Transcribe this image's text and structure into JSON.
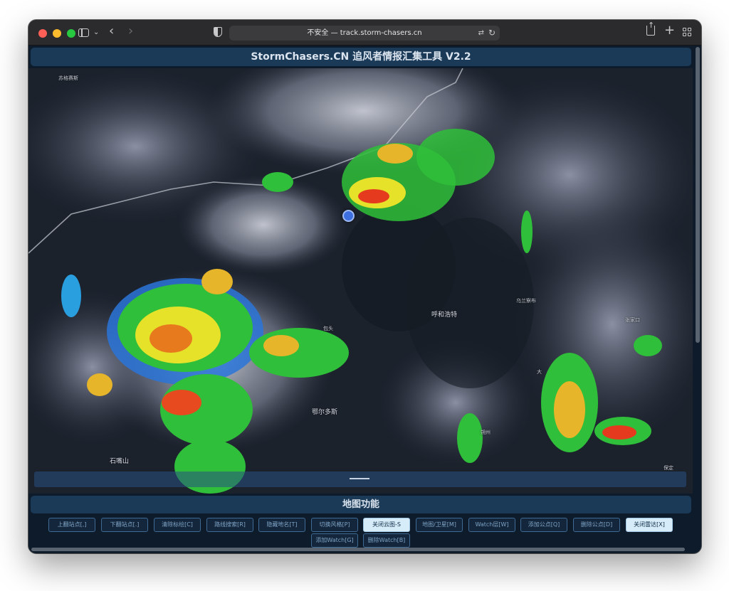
{
  "browser": {
    "address_text": "不安全 — track.storm-chasers.cn",
    "icons": [
      "sidebar-icon",
      "back-icon",
      "forward-icon",
      "shield-icon",
      "translate-icon",
      "reload-icon",
      "share-icon",
      "new-tab-icon",
      "tab-overview-icon"
    ]
  },
  "app": {
    "title": "StormChasers.CN 追风者情报汇集工具 V2.2",
    "section_title": "地图功能"
  },
  "map": {
    "places": {
      "sugeqi": "苏格赛斯",
      "hohhot": "呼和浩特",
      "wulanchabu": "乌兰察布",
      "baotou": "包头",
      "ordos": "鄂尔多斯",
      "zhangjiakou": "张家口",
      "datong": "大",
      "shuozhou": "朔州",
      "shizuishan": "石嘴山",
      "baoding": "保定"
    }
  },
  "buttons": [
    "上翻站点[,]",
    "下翻站点[.]",
    "清除标绘[C]",
    "路线搜索[R]",
    "隐藏地名[T]",
    "切换风格[P]",
    "关闭云图-S",
    "地图/卫星[M]",
    "Watch层[W]",
    "添加公点[Q]",
    "删除公点[D]",
    "关闭雷达[X]",
    "添加Watch[G]",
    "删除Watch[B]"
  ],
  "active_buttons": [
    "关闭云图-S",
    "关闭雷达[X]"
  ],
  "colors": {
    "header_bg": "#1a3a58",
    "active_button_bg": "#d7ecf9",
    "location_dot": "#3d6fe0"
  }
}
